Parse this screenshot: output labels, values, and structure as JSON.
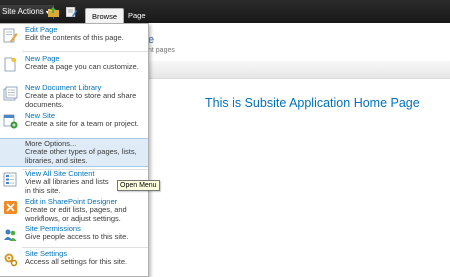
{
  "ribbon": {
    "site_actions_label": "Site Actions",
    "dropdown_glyph": "▾",
    "tabs": [
      {
        "label": "Browse",
        "active": true
      },
      {
        "label": "Page",
        "active": false
      }
    ]
  },
  "background": {
    "title_fragment": "e",
    "subtitle_fragment": "nt pages",
    "main_heading": "This is Subsite Application Home Page"
  },
  "menu": {
    "items": [
      {
        "title": "Edit Page",
        "desc": "Edit the contents of this page.",
        "icon": "edit-page-icon"
      },
      {
        "title": "New Page",
        "desc": "Create a page you can customize.",
        "icon": "new-page-icon"
      },
      {
        "title": "New Document Library",
        "desc": "Create a place to store and share documents.",
        "icon": "document-library-icon"
      },
      {
        "title": "New Site",
        "desc": "Create a site for a team or project.",
        "icon": "new-site-icon"
      },
      {
        "title": "More Options...",
        "desc": "Create other types of pages, lists, libraries, and sites.",
        "icon": "more-options-icon"
      },
      {
        "title": "View All Site Content",
        "desc": "View all libraries and lists in this site.",
        "icon": "site-content-icon"
      },
      {
        "title": "Edit in SharePoint Designer",
        "desc": "Create or edit lists, pages, and workflows, or adjust settings.",
        "icon": "sharepoint-designer-icon"
      },
      {
        "title": "Site Permissions",
        "desc": "Give people access to this site.",
        "icon": "site-permissions-icon"
      },
      {
        "title": "Site Settings",
        "desc": "Access all settings for this site.",
        "icon": "site-settings-icon"
      }
    ]
  },
  "tooltip": {
    "text": "Open Menu"
  },
  "colors": {
    "link": "#0072bc",
    "highlight": "#dfecf7",
    "ribbon": "#1f1f1f"
  }
}
